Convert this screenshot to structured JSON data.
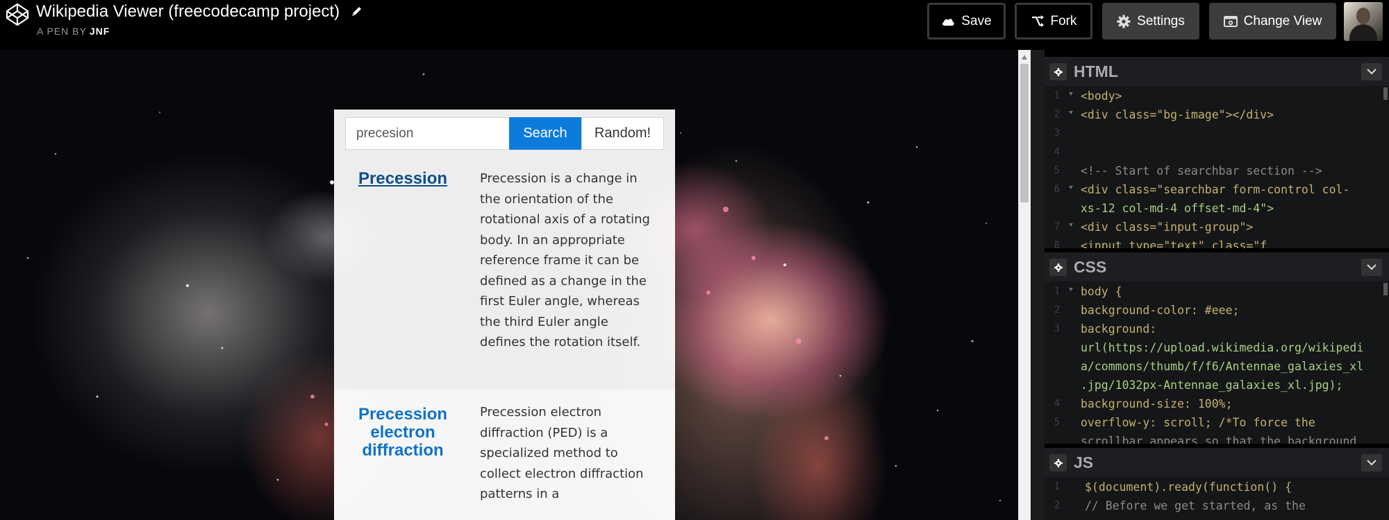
{
  "header": {
    "title": "Wikipedia Viewer (freecodecamp project)",
    "by_label": "A PEN BY",
    "author": "JNF",
    "buttons": {
      "save": "Save",
      "fork": "Fork",
      "settings": "Settings",
      "change_view": "Change View"
    }
  },
  "preview": {
    "search": {
      "value": "precesion",
      "button": "Search",
      "random": "Random!"
    },
    "results": [
      {
        "title": "Precession",
        "extract": "Precession is a change in the orientation of the rotational axis of a rotating body. In an appropriate reference frame it can be defined as a change in the first Euler angle, whereas the third Euler angle defines the rotation itself."
      },
      {
        "title": "Precession electron diffraction",
        "extract": "Precession electron diffraction (PED) is a specialized method to collect electron diffraction patterns in a"
      }
    ]
  },
  "editors": {
    "html": {
      "title": "HTML",
      "lines": [
        {
          "n": "1",
          "text": "<body>"
        },
        {
          "n": "2",
          "text": "  <div class=\"bg-image\"></div>"
        },
        {
          "n": "3",
          "text": ""
        },
        {
          "n": "4",
          "text": ""
        },
        {
          "n": "5",
          "text": "  <!-- Start of searchbar section -->"
        },
        {
          "n": "6",
          "text": "  <div class=\"searchbar form-control col-"
        },
        {
          "n": "",
          "text": "xs-12 col-md-4 offset-md-4\">"
        },
        {
          "n": "7",
          "text": "    <div class=\"input-group\">"
        },
        {
          "n": "8",
          "text": "      <input type=\"text\" class=\"f"
        }
      ]
    },
    "css": {
      "title": "CSS",
      "lines": [
        {
          "n": "1",
          "text": "body {"
        },
        {
          "n": "2",
          "text": "  background-color: #eee;"
        },
        {
          "n": "3",
          "text": "  background:"
        },
        {
          "n": "",
          "text": "url(https://upload.wikimedia.org/wikipedi"
        },
        {
          "n": "",
          "text": "a/commons/thumb/f/f6/Antennae_galaxies_xl"
        },
        {
          "n": "",
          "text": ".jpg/1032px-Antennae_galaxies_xl.jpg);"
        },
        {
          "n": "4",
          "text": "  background-size: 100%;"
        },
        {
          "n": "5",
          "text": "  overflow-y: scroll; /*To force the"
        },
        {
          "n": "",
          "text": "  scrollbar appears so that the background"
        }
      ]
    },
    "js": {
      "title": "JS",
      "lines": [
        {
          "n": "1",
          "text": "$(document).ready(function() {"
        },
        {
          "n": "2",
          "text": "  // Before we get started, as the"
        }
      ]
    }
  }
}
